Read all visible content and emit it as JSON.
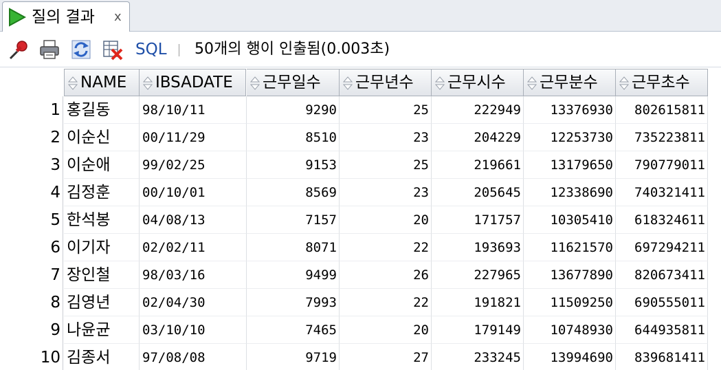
{
  "tab": {
    "label": "질의 결과",
    "close": "x"
  },
  "toolbar": {
    "sql_label": "SQL",
    "separator": "|",
    "status": "50개의 행이 인출됨(0.003초)",
    "icons": [
      "pin-icon",
      "print-icon",
      "refresh-icon",
      "delete-icon"
    ]
  },
  "grid": {
    "columns": [
      "NAME",
      "IBSADATE",
      "근무일수",
      "근무년수",
      "근무시수",
      "근무분수",
      "근무초수"
    ],
    "rows": [
      [
        "1",
        "홍길동",
        "98/10/11",
        "9290",
        "25",
        "222949",
        "13376930",
        "802615811"
      ],
      [
        "2",
        "이순신",
        "00/11/29",
        "8510",
        "23",
        "204229",
        "12253730",
        "735223811"
      ],
      [
        "3",
        "이순애",
        "99/02/25",
        "9153",
        "25",
        "219661",
        "13179650",
        "790779011"
      ],
      [
        "4",
        "김정훈",
        "00/10/01",
        "8569",
        "23",
        "205645",
        "12338690",
        "740321411"
      ],
      [
        "5",
        "한석봉",
        "04/08/13",
        "7157",
        "20",
        "171757",
        "10305410",
        "618324611"
      ],
      [
        "6",
        "이기자",
        "02/02/11",
        "8071",
        "22",
        "193693",
        "11621570",
        "697294211"
      ],
      [
        "7",
        "장인철",
        "98/03/16",
        "9499",
        "26",
        "227965",
        "13677890",
        "820673411"
      ],
      [
        "8",
        "김영년",
        "02/04/30",
        "7993",
        "22",
        "191821",
        "11509250",
        "690555011"
      ],
      [
        "9",
        "나윤균",
        "03/10/10",
        "7465",
        "20",
        "179149",
        "10748930",
        "644935811"
      ],
      [
        "10",
        "김종서",
        "97/08/08",
        "9719",
        "27",
        "233245",
        "13994690",
        "839681411"
      ]
    ]
  },
  "colors": {
    "play": "#2ea82a",
    "sql_link": "#1f4fa8",
    "pin": "#d8262c"
  }
}
